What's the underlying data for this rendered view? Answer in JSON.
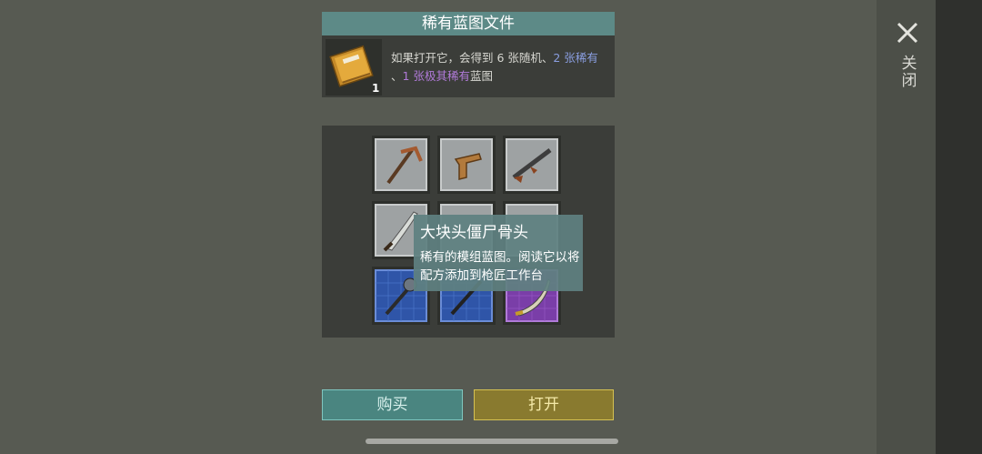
{
  "close": {
    "label": "关闭"
  },
  "item": {
    "title": "稀有蓝图文件",
    "count": "1",
    "desc": {
      "part1": "如果打开它，会得到 6 张随机、",
      "rare": "2 张稀有",
      "part2": "、",
      "epic": "1 张极其稀有",
      "part3": "蓝图"
    }
  },
  "grid": {
    "cells": [
      {
        "icon": "pickaxe-icon",
        "rarity": "common"
      },
      {
        "icon": "pistol-icon",
        "rarity": "common"
      },
      {
        "icon": "assault-rifle-icon",
        "rarity": "common"
      },
      {
        "icon": "machete-icon",
        "rarity": "common"
      },
      {
        "icon": "blade-icon",
        "rarity": "common"
      },
      {
        "icon": "sword-icon",
        "rarity": "common"
      },
      {
        "icon": "spiked-club-icon",
        "rarity": "rare"
      },
      {
        "icon": "staff-icon",
        "rarity": "rare"
      },
      {
        "icon": "curved-blade-icon",
        "rarity": "epic"
      }
    ]
  },
  "tooltip": {
    "title": "大块头僵尸骨头",
    "body": "稀有的模组蓝图。阅读它以将配方添加到枪匠工作台"
  },
  "buttons": {
    "buy": "购买",
    "open": "打开"
  },
  "colors": {
    "header": "#5d8a87",
    "rare_text": "#8a9ee0",
    "epic_text": "#b07ad8",
    "buy_button": "#4a8580",
    "open_button": "#897a2f"
  }
}
